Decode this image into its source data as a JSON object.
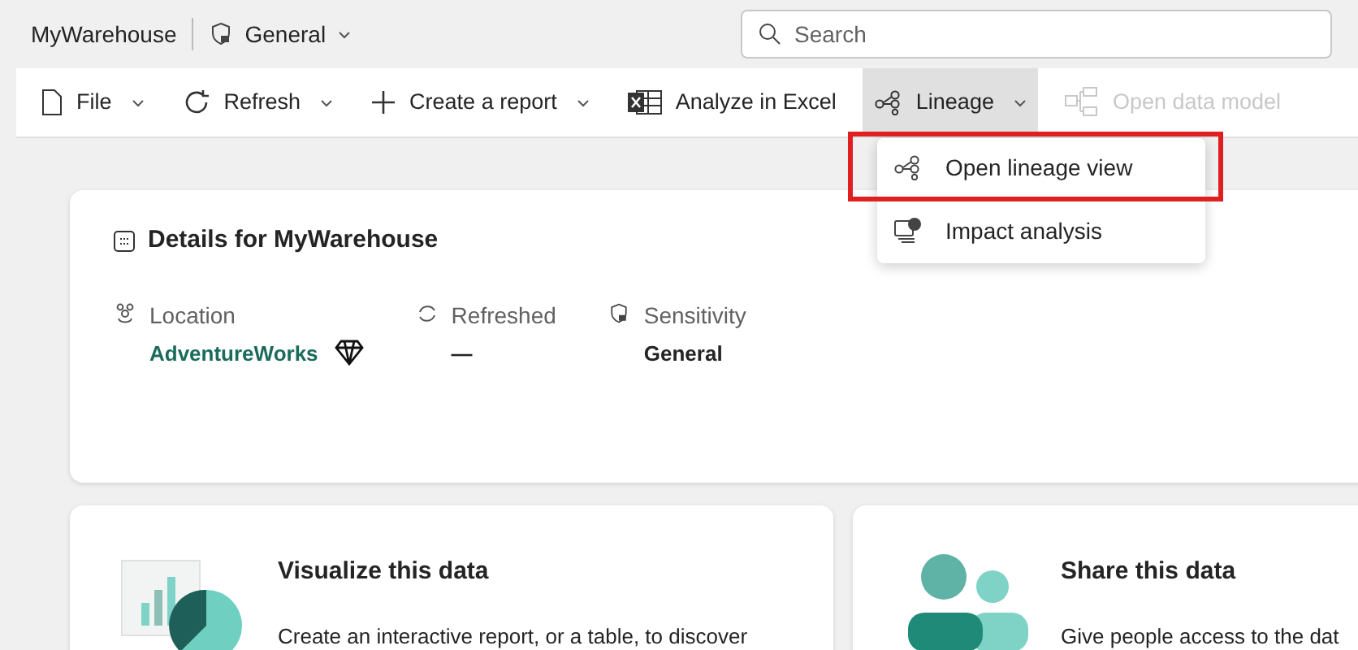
{
  "header": {
    "title": "MyWarehouse",
    "sensitivity": "General",
    "search": {
      "placeholder": "Search"
    }
  },
  "toolbar": [
    {
      "kind": "file",
      "label": "File",
      "dropdown": true,
      "selected": false,
      "disabled": false
    },
    {
      "kind": "refresh",
      "label": "Refresh",
      "dropdown": true,
      "selected": false,
      "disabled": false
    },
    {
      "kind": "plus",
      "label": "Create a report",
      "dropdown": true,
      "selected": false,
      "disabled": false
    },
    {
      "kind": "excel",
      "label": "Analyze in Excel",
      "dropdown": false,
      "selected": false,
      "disabled": false
    },
    {
      "kind": "lineage",
      "label": "Lineage",
      "dropdown": true,
      "selected": true,
      "disabled": false
    },
    {
      "kind": "model",
      "label": "Open data model",
      "dropdown": false,
      "selected": false,
      "disabled": true
    }
  ],
  "menu": [
    {
      "kind": "lineage",
      "label": "Open lineage view",
      "highlighted": true
    },
    {
      "kind": "impact",
      "label": "Impact analysis",
      "highlighted": false
    }
  ],
  "details": {
    "title": "Details for MyWarehouse",
    "fields": [
      {
        "kind": "location",
        "label": "Location",
        "value": "AdventureWorks",
        "link": true
      },
      {
        "kind": "refreshed",
        "label": "Refreshed",
        "value": "—",
        "link": false
      },
      {
        "kind": "sensitivity",
        "label": "Sensitivity",
        "value": "General",
        "link": false
      }
    ]
  },
  "cards": [
    {
      "kind": "visualize",
      "title": "Visualize this data",
      "text": "Create an interactive report, or a table, to discover"
    },
    {
      "kind": "share",
      "title": "Share this data",
      "text": "Give people access to the dat"
    }
  ]
}
